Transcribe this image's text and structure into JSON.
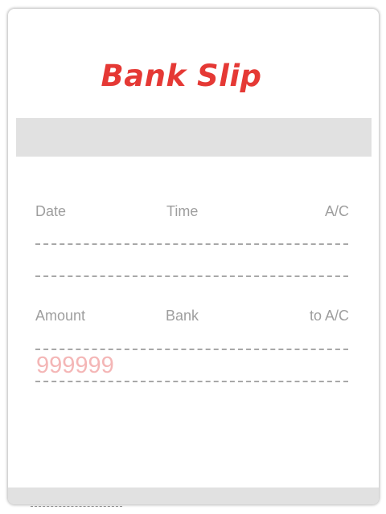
{
  "slip": {
    "title": "Bank Slip",
    "title_color": "#e53935",
    "row1": {
      "date_label": "Date",
      "time_label": "Time",
      "account_label": "A/C"
    },
    "row2": {
      "amount_label": "Amount",
      "bank_label": "Bank",
      "to_account_label": "to A/C",
      "amount_value": "999999",
      "amount_value_color": "#f4b6b6"
    }
  }
}
